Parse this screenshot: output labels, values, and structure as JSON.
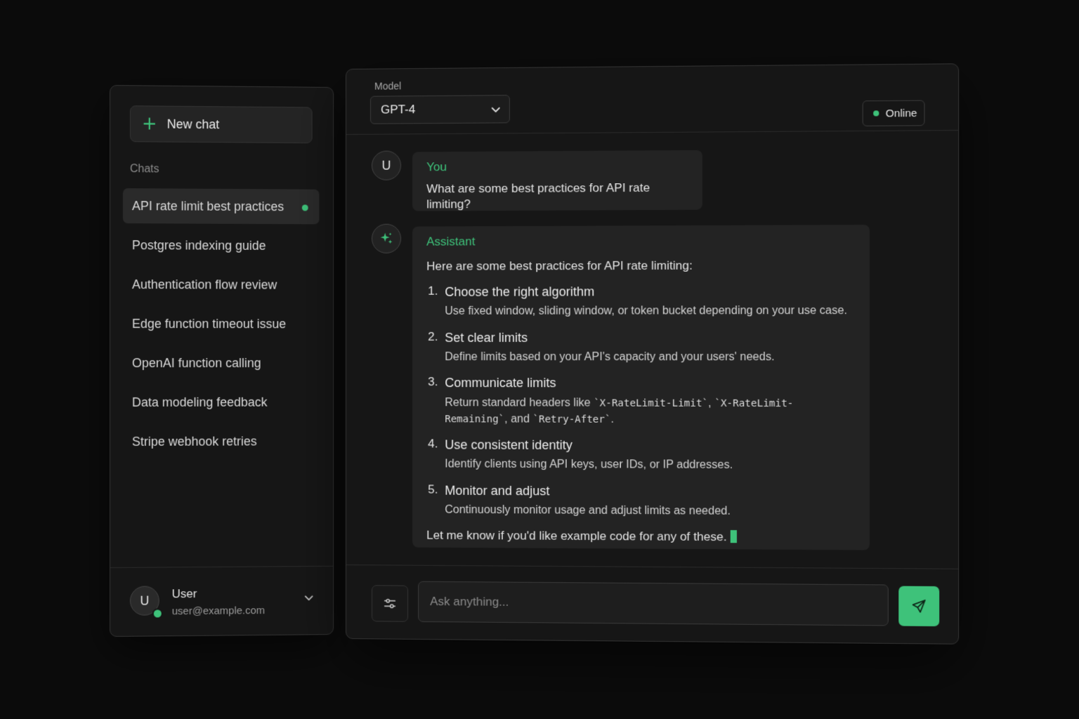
{
  "sidebar": {
    "new_chat_label": "New chat",
    "chats_heading": "Chats",
    "chats": [
      {
        "label": "API rate limit best practices",
        "active": true
      },
      {
        "label": "Postgres indexing guide"
      },
      {
        "label": "Authentication flow review"
      },
      {
        "label": "Edge function timeout issue"
      },
      {
        "label": "OpenAI function calling"
      },
      {
        "label": "Data modeling feedback"
      },
      {
        "label": "Stripe webhook retries"
      }
    ],
    "user": {
      "initial": "U",
      "name": "User",
      "email": "user@example.com"
    }
  },
  "header": {
    "model_label": "Model",
    "model_value": "GPT-4",
    "status": "Online"
  },
  "conversation": {
    "user_message": {
      "avatar": "U",
      "sender": "You",
      "text": "What are some best practices for API rate limiting?"
    },
    "assistant_message": {
      "avatar_icon": "sparkle-icon",
      "sender": "Assistant",
      "intro": "Here are some best practices for API rate limiting:",
      "steps": [
        {
          "num": "1.",
          "title": "Choose the right algorithm",
          "desc": "Use fixed window, sliding window, or token bucket depending on your use case."
        },
        {
          "num": "2.",
          "title": "Set clear limits",
          "desc": "Define limits based on your API's capacity and your users' needs."
        },
        {
          "num": "3.",
          "title": "Communicate limits",
          "desc_before": "Return standard headers like ",
          "code1": "`X-RateLimit-Limit`",
          "sep1": ", ",
          "code2": "`X-RateLimit-Remaining`",
          "sep2": ", and ",
          "code3": "`Retry-After`",
          "desc_after": "."
        },
        {
          "num": "4.",
          "title": "Use consistent identity",
          "desc": "Identify clients using API keys, user IDs, or IP addresses."
        },
        {
          "num": "5.",
          "title": "Monitor and adjust",
          "desc": "Continuously monitor usage and adjust limits as needed."
        }
      ],
      "outro": "Let me know if you'd like example code for any of these."
    }
  },
  "composer": {
    "placeholder": "Ask anything..."
  },
  "colors": {
    "accent": "#3ec27a",
    "background": "#0b0b0b",
    "panel": "#161616",
    "bubble": "#232323"
  }
}
